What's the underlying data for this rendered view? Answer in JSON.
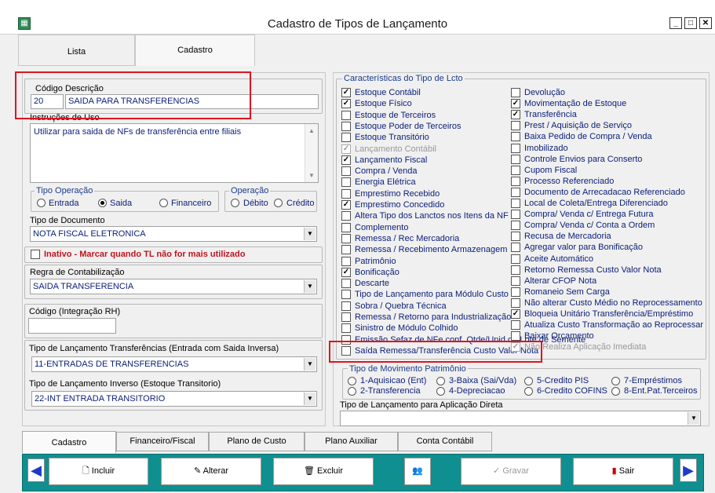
{
  "window": {
    "title": "Cadastro de Tipos de Lançamento",
    "icon": "app-grid-icon"
  },
  "top_tabs": [
    "Lista",
    "Cadastro"
  ],
  "codigo": {
    "label": "Código",
    "value": "20"
  },
  "descricao": {
    "label": "Descrição",
    "value": "SAIDA PARA TRANSFERENCIAS"
  },
  "instrucoes": {
    "label": "Instruções de Uso",
    "value": "Utilizar para saida de NFs de transferência entre filiais"
  },
  "tipo_operacao": {
    "label": "Tipo Operação",
    "options": [
      "Entrada",
      "Saida",
      "Financeiro"
    ],
    "selected": "Saida"
  },
  "operacao": {
    "label": "Operação",
    "options": [
      "Débito",
      "Crédito"
    ]
  },
  "tipo_documento": {
    "label": "Tipo de Documento",
    "value": "NOTA FISCAL ELETRONICA"
  },
  "inativo": {
    "label": "Inativo - Marcar quando TL não for mais utilizado",
    "color": "#c0141e"
  },
  "regra": {
    "label": "Regra de Contabilização",
    "value": "SAIDA TRANSFERENCIA"
  },
  "codigo_rh": {
    "label": "Código (Integração RH)",
    "value": ""
  },
  "tl_transf": {
    "label": "Tipo de Lançamento Transferências (Entrada com Saida Inversa)",
    "value": "11-ENTRADAS DE TRANSFERENCIAS"
  },
  "tl_inverso": {
    "label": "Tipo de Lançamento Inverso (Estoque Transitorio)",
    "value": "22-INT ENTRADA TRANSITORIO"
  },
  "caracteristicas": {
    "title": "Características do Tipo de Lcto",
    "left": [
      {
        "label": "Estoque Contábil",
        "checked": true
      },
      {
        "label": "Estoque Físico",
        "checked": true
      },
      {
        "label": "Estoque de Terceiros",
        "checked": false
      },
      {
        "label": "Estoque Poder de Terceiros",
        "checked": false
      },
      {
        "label": "Estoque Transitório",
        "checked": false
      },
      {
        "label": "Lançamento Contábil",
        "checked": true,
        "disabled": true
      },
      {
        "label": "Lançamento Fiscal",
        "checked": true
      },
      {
        "label": "Compra / Venda",
        "checked": false
      },
      {
        "label": "Energia Elétrica",
        "checked": false
      },
      {
        "label": "Emprestimo Recebido",
        "checked": false
      },
      {
        "label": "Emprestimo Concedido",
        "checked": true
      },
      {
        "label": "Altera Tipo dos Lanctos nos Itens da NF",
        "checked": false
      },
      {
        "label": "Complemento",
        "checked": false
      },
      {
        "label": "Remessa / Rec Mercadoria",
        "checked": false
      },
      {
        "label": "Remessa / Recebimento Armazenagem",
        "checked": false
      },
      {
        "label": "Patrimônio",
        "checked": false
      },
      {
        "label": "Bonificação",
        "checked": true
      },
      {
        "label": "Descarte",
        "checked": false
      },
      {
        "label": "Tipo de Lançamento para Módulo Custo",
        "checked": false
      },
      {
        "label": "Sobra / Quebra Técnica",
        "checked": false
      },
      {
        "label": "Remessa / Retorno para Industrialização",
        "checked": false
      },
      {
        "label": "Sinistro de Módulo Colhido",
        "checked": false
      },
      {
        "label": "Emissão Sefaz de NFe conf. Qtde/Unid do Lote de Semente",
        "checked": false
      },
      {
        "label": "Saída Remessa/Transferência Custo Valor Nota",
        "checked": false
      }
    ],
    "right": [
      {
        "label": "Devolução",
        "checked": false
      },
      {
        "label": "Movimentação de Estoque",
        "checked": true
      },
      {
        "label": "Transferência",
        "checked": true
      },
      {
        "label": "Prest / Aquisição de Serviço",
        "checked": false
      },
      {
        "label": "Baixa Pedido de Compra / Venda",
        "checked": false
      },
      {
        "label": "Imobilizado",
        "checked": false
      },
      {
        "label": "Controle Envios para Conserto",
        "checked": false
      },
      {
        "label": "Cupom Fiscal",
        "checked": false
      },
      {
        "label": "Processo Referenciado",
        "checked": false
      },
      {
        "label": "Documento de Arrecadacao Referenciado",
        "checked": false
      },
      {
        "label": "Local de Coleta/Entrega Diferenciado",
        "checked": false
      },
      {
        "label": "Compra/ Venda c/ Entrega Futura",
        "checked": false
      },
      {
        "label": "Compra/ Venda c/ Conta a Ordem",
        "checked": false
      },
      {
        "label": "Recusa de Mercadoria",
        "checked": false
      },
      {
        "label": "Agregar valor para Bonificação",
        "checked": false
      },
      {
        "label": "Aceite Automático",
        "checked": false
      },
      {
        "label": "Retorno Remessa Custo Valor Nota",
        "checked": false
      },
      {
        "label": "Alterar CFOP Nota",
        "checked": false
      },
      {
        "label": "Romaneio Sem Carga",
        "checked": false
      },
      {
        "label": "Não alterar Custo Médio no Reprocessamento",
        "checked": false
      },
      {
        "label": "Bloqueia Unitário Transferência/Empréstimo",
        "checked": true
      },
      {
        "label": "Atualiza Custo Transformação ao Reprocessar",
        "checked": false
      },
      {
        "label": "Baixar Orçamento",
        "checked": false
      },
      {
        "label": "Não Realiza Aplicação Imediata",
        "checked": true,
        "disabled": true
      }
    ]
  },
  "movimento": {
    "title": "Tipo de Movimento Patrimônio",
    "options": [
      "1-Aquisicao (Ent)",
      "3-Baixa (Sai/Vda)",
      "5-Credito PIS",
      "7-Empréstimos",
      "2-Transferencia",
      "4-Depreciacao",
      "6-Credito COFINS",
      "8-Ent.Pat.Terceiros"
    ]
  },
  "aplicacao": {
    "label": "Tipo de Lançamento para Aplicação Direta",
    "value": ""
  },
  "bottom_tabs": [
    "Cadastro",
    "Financeiro/Fiscal",
    "Plano de Custo",
    "Plano Auxiliar",
    "Conta Contábil"
  ],
  "toolbar": {
    "incluir": "Incluir",
    "alterar": "Alterar",
    "excluir": "Excluir",
    "gravar": "Gravar",
    "sair": "Sair",
    "color": "#0f8f8f"
  }
}
